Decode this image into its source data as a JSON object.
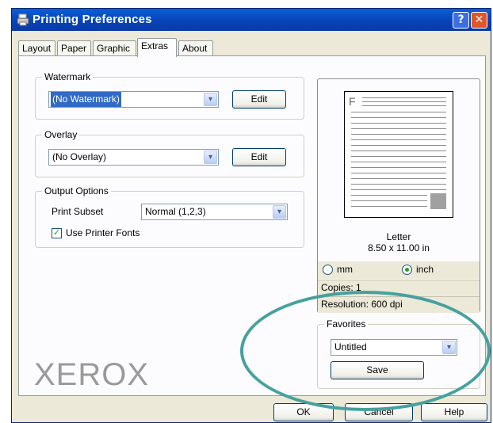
{
  "window": {
    "title": "Printing Preferences",
    "help_glyph": "?",
    "close_glyph": "✕"
  },
  "tabs": [
    {
      "label": "Layout"
    },
    {
      "label": "Paper"
    },
    {
      "label": "Graphic"
    },
    {
      "label": "Extras",
      "active": true
    },
    {
      "label": "About"
    }
  ],
  "watermark": {
    "legend": "Watermark",
    "selected": "(No Watermark)",
    "edit_label": "Edit"
  },
  "overlay": {
    "legend": "Overlay",
    "selected": "(No Overlay)",
    "edit_label": "Edit"
  },
  "output_options": {
    "legend": "Output Options",
    "print_subset_label": "Print Subset",
    "print_subset_value": "Normal (1,2,3)",
    "use_printer_fonts_label": "Use Printer Fonts",
    "use_printer_fonts_checked": true,
    "check_glyph": "✓"
  },
  "preview": {
    "page_letter": "F",
    "paper_name": "Letter",
    "paper_size": "8.50 x 11.00 in",
    "unit_mm_label": "mm",
    "unit_inch_label": "inch",
    "selected_unit": "inch",
    "copies": "Copies: 1",
    "resolution": "Resolution: 600 dpi"
  },
  "favorites": {
    "legend": "Favorites",
    "selected": "Untitled",
    "save_label": "Save"
  },
  "brand_logo": "XEROX",
  "footer": {
    "ok_label": "OK",
    "cancel_label": "Cancel",
    "help_label": "Help"
  },
  "colors": {
    "title_bar": "#0a52d0",
    "annotation_oval": "#46a19e",
    "selection": "#316ac5"
  },
  "combo_arrow_glyph": "▾"
}
